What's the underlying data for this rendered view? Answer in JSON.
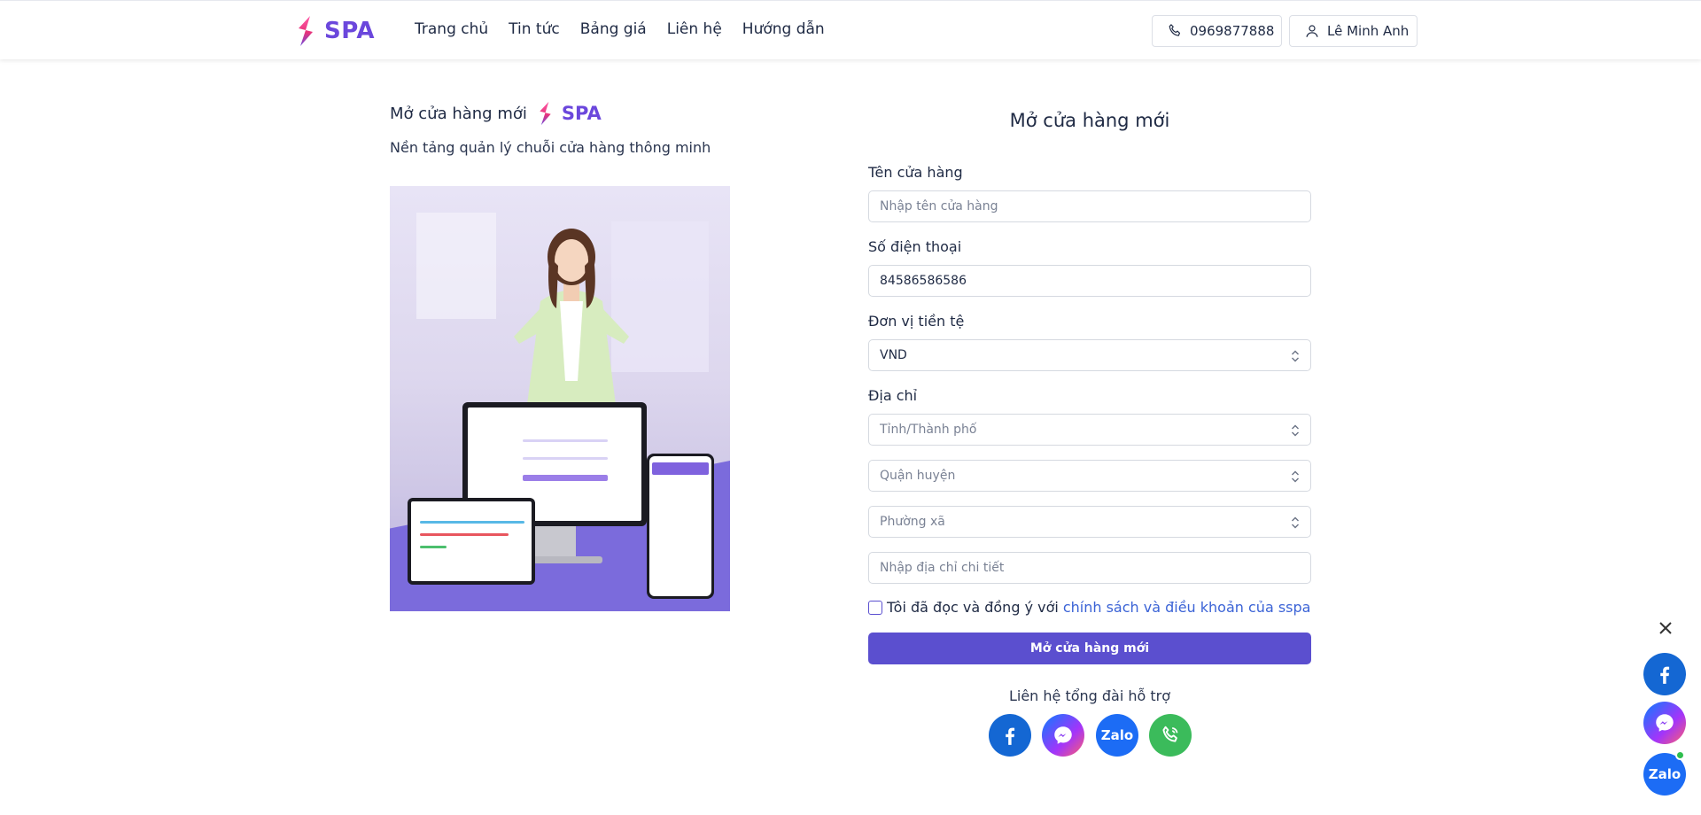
{
  "header": {
    "brand": "SPA",
    "nav": [
      "Trang chủ",
      "Tin tức",
      "Bảng giá",
      "Liên hệ",
      "Hướng dẫn"
    ],
    "phone": "0969877888",
    "user": "Lê Minh Anh"
  },
  "intro": {
    "title": "Mở cửa hàng mới",
    "brand": "SPA",
    "subtitle": "Nền tảng quản lý chuỗi cửa hàng thông minh"
  },
  "form": {
    "title": "Mở cửa hàng mới",
    "store_name_label": "Tên cửa hàng",
    "store_name_placeholder": "Nhập tên cửa hàng",
    "phone_label": "Số điện thoại",
    "phone_value": "84586586586",
    "currency_label": "Đơn vị tiền tệ",
    "currency_value": "VND",
    "address_label": "Địa chỉ",
    "province_placeholder": "Tỉnh/Thành phố",
    "district_placeholder": "Quận huyện",
    "ward_placeholder": "Phường xã",
    "address_detail_placeholder": "Nhập địa chỉ chi tiết",
    "agree_text": "Tôi đã đọc và đồng ý với",
    "agree_link": "chính sách và điều khoản của sspa",
    "submit_label": "Mở cửa hàng mới",
    "support_label": "Liên hệ tổng đài hỗ trợ"
  },
  "social": {
    "zalo_label": "Zalo"
  },
  "colors": {
    "brand": "#6b47dc",
    "button": "#5b4fcf",
    "link": "#3b63d6"
  }
}
